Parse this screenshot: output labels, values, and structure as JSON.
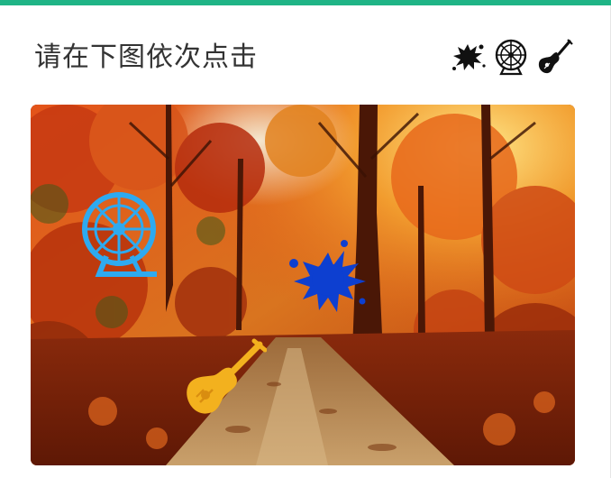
{
  "prompt": "请在下图依次点击",
  "targets": [
    {
      "icon": "paint-splat-icon",
      "color": "#111111"
    },
    {
      "icon": "ferris-wheel-icon",
      "color": "#111111"
    },
    {
      "icon": "electric-guitar-icon",
      "color": "#111111"
    }
  ],
  "scene_icons": [
    {
      "icon": "ferris-wheel-icon",
      "color": "#2eaaf0"
    },
    {
      "icon": "paint-splat-icon",
      "color": "#0d3fd0"
    },
    {
      "icon": "electric-guitar-icon",
      "color": "#f3b11e"
    }
  ],
  "colors": {
    "accent": "#1fb486",
    "prompt_text": "#333333"
  }
}
